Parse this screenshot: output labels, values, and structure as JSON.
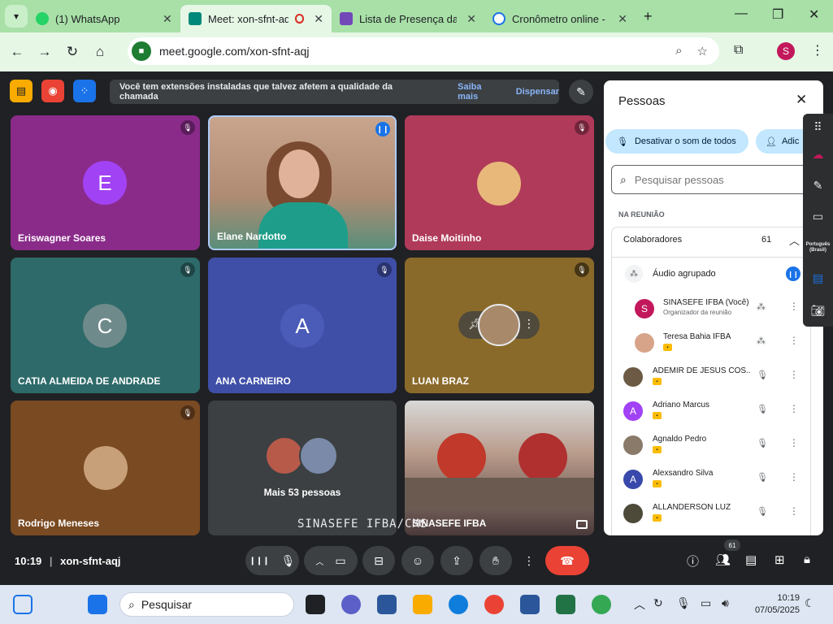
{
  "browser": {
    "tabs": [
      {
        "label": "(1) WhatsApp",
        "color": "#25d366"
      },
      {
        "label": "Meet: xon-sfnt-aqj",
        "color": "#00897b",
        "active": true
      },
      {
        "label": "Lista de Presença da A",
        "color": "#7248b9"
      },
      {
        "label": "Cronômetro online - R",
        "color": "#1a73e8"
      }
    ],
    "url": "meet.google.com/xon-sfnt-aqj",
    "profile_initial": "S"
  },
  "meet": {
    "banner": {
      "message": "Você tem extensões instaladas que talvez afetem a qualidade da chamada",
      "learn_more": "Saiba mais",
      "dismiss": "Dispensar"
    },
    "tiles": [
      {
        "name": "Eriswagner Soares",
        "initial": "E"
      },
      {
        "name": "Elane Nardotto"
      },
      {
        "name": "Daise Moitinho"
      },
      {
        "name": "CATIA ALMEIDA DE ANDRADE",
        "initial": "C"
      },
      {
        "name": "ANA CARNEIRO",
        "initial": "A"
      },
      {
        "name": "LUAN BRAZ"
      },
      {
        "name": "Rodrigo Meneses"
      },
      {
        "name": "Mais 53 pessoas"
      },
      {
        "name": "SINASEFE IFBA"
      }
    ],
    "watermark": "SINASEFE IFBA/CMS",
    "time": "10:19",
    "meeting_code": "xon-sfnt-aqj",
    "people_count_badge": "61"
  },
  "panel": {
    "title": "Pessoas",
    "mute_all": "Desativar o som de todos",
    "add": "Adic",
    "search_placeholder": "Pesquisar pessoas",
    "section": "NA REUNIÃO",
    "group": {
      "label": "Colaboradores",
      "count": "61"
    },
    "audio_group": "Áudio agrupado",
    "people": [
      {
        "name": "SINASEFE IFBA (Você)",
        "sub": "Organizador da reunião",
        "initial": "S",
        "color": "#c2185b"
      },
      {
        "name": "Teresa Bahia IFBA",
        "initial": "",
        "color": "#d7a48a"
      },
      {
        "name": "ADEMIR DE JESUS COS...",
        "initial": "",
        "color": "#6d5a44"
      },
      {
        "name": "Adriano Marcus",
        "initial": "A",
        "color": "#a142f4"
      },
      {
        "name": "Agnaldo Pedro",
        "initial": "",
        "color": "#8a7a6a"
      },
      {
        "name": "Alexsandro Silva",
        "initial": "A",
        "color": "#3949ab"
      },
      {
        "name": "ALLANDERSON LUZ",
        "initial": "",
        "color": "#4e4a3a"
      }
    ]
  },
  "sidetools": {
    "language": "Português (Brasil)"
  },
  "taskbar": {
    "search": "Pesquisar",
    "time": "10:19",
    "date": "07/05/2025"
  }
}
